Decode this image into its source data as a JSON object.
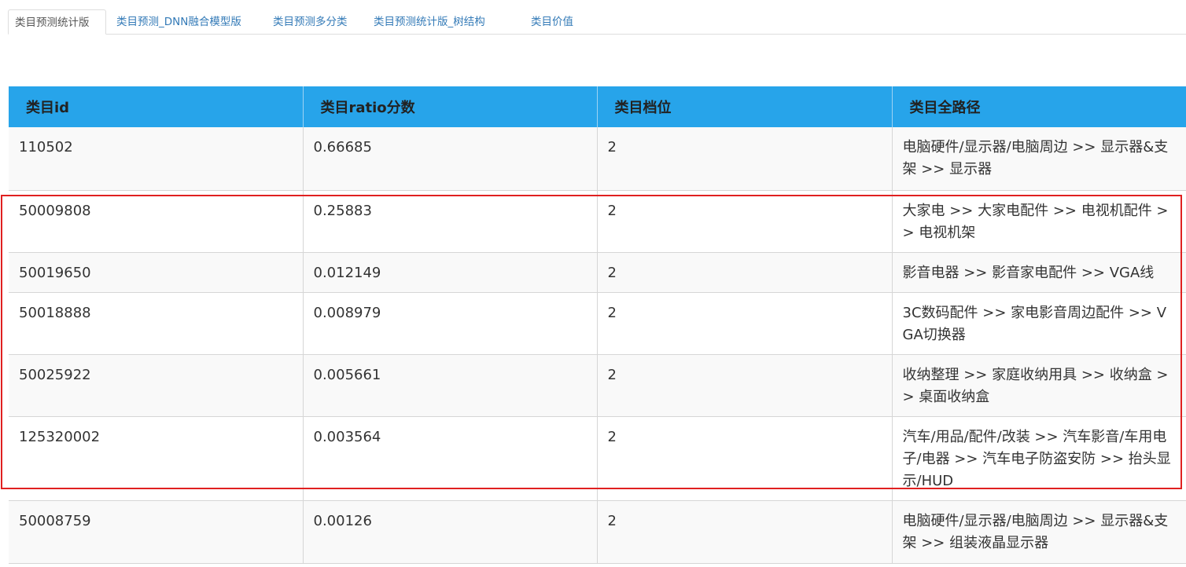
{
  "tabs": [
    {
      "label": "类目预测统计版",
      "active": true
    },
    {
      "label": "类目预测_DNN融合模型版",
      "active": false
    },
    {
      "label": "类目预测多分类",
      "active": false
    },
    {
      "label": "类目预测统计版_树结构",
      "active": false
    },
    {
      "label": "类目价值",
      "active": false
    }
  ],
  "table": {
    "headers": [
      "类目id",
      "类目ratio分数",
      "类目档位",
      "类目全路径"
    ],
    "rows": [
      {
        "id": "110502",
        "ratio": "0.66685",
        "level": "2",
        "path": "电脑硬件/显示器/电脑周边 >> 显示器&支架 >> 显示器"
      },
      {
        "id": "50009808",
        "ratio": "0.25883",
        "level": "2",
        "path": "大家电 >> 大家电配件 >> 电视机配件 >> 电视机架"
      },
      {
        "id": "50019650",
        "ratio": "0.012149",
        "level": "2",
        "path": "影音电器 >> 影音家电配件 >> VGA线"
      },
      {
        "id": "50018888",
        "ratio": "0.008979",
        "level": "2",
        "path": "3C数码配件 >> 家电影音周边配件 >> VGA切换器"
      },
      {
        "id": "50025922",
        "ratio": "0.005661",
        "level": "2",
        "path": "收纳整理 >> 家庭收纳用具 >> 收纳盒 >> 桌面收纳盒"
      },
      {
        "id": "125320002",
        "ratio": "0.003564",
        "level": "2",
        "path": "汽车/用品/配件/改装 >> 汽车影音/车用电子/电器 >> 汽车电子防盗安防 >> 抬头显示/HUD"
      },
      {
        "id": "50008759",
        "ratio": "0.00126",
        "level": "2",
        "path": "电脑硬件/显示器/电脑周边 >> 显示器&支架 >> 组装液晶显示器"
      }
    ]
  },
  "colors": {
    "header_bg": "#27a4ea",
    "tab_link": "#337ab7",
    "highlight_border": "#e02020"
  }
}
